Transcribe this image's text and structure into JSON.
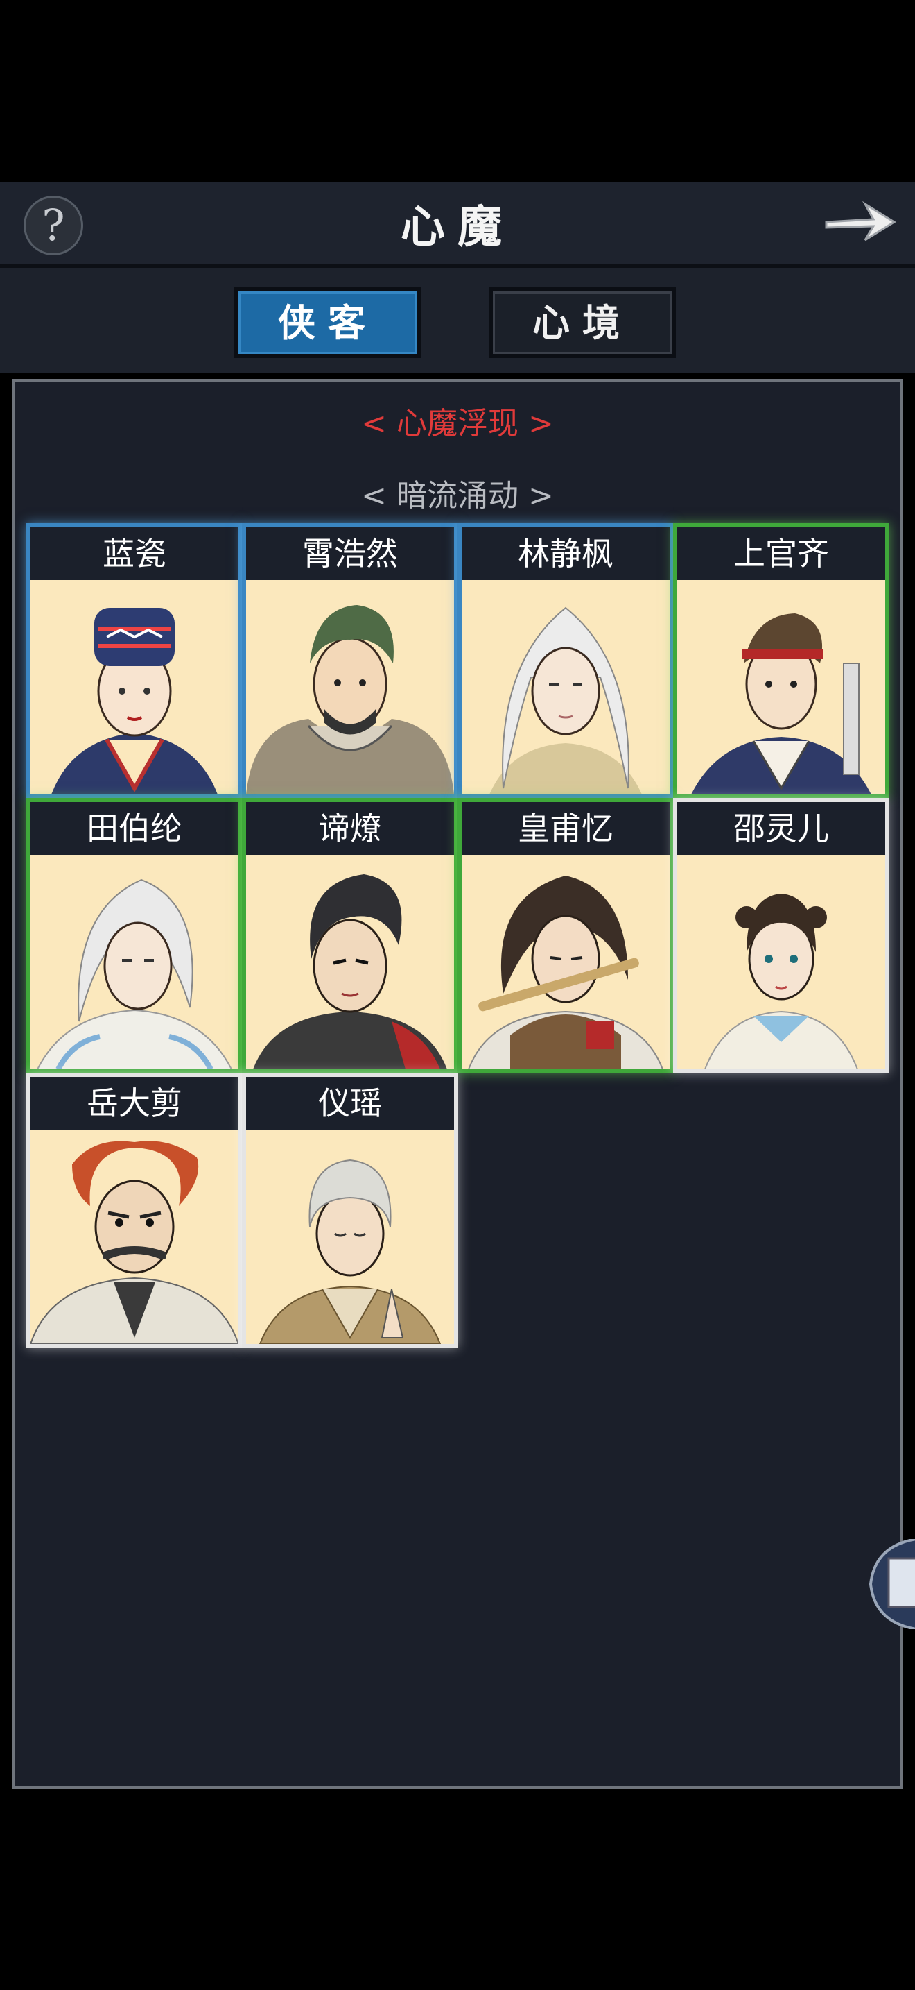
{
  "header": {
    "title": "心魔",
    "help_label": "?"
  },
  "tabs": [
    {
      "label": "侠客",
      "active": true
    },
    {
      "label": "心境",
      "active": false
    }
  ],
  "sections": [
    {
      "label": "< 心魔浮现 >",
      "color": "#e03a3a"
    },
    {
      "label": "< 暗流涌动 >",
      "color": "#b9bcc2"
    }
  ],
  "characters": [
    {
      "name": "蓝瓷",
      "rarity": "blue"
    },
    {
      "name": "霄浩然",
      "rarity": "blue"
    },
    {
      "name": "林静枫",
      "rarity": "blue"
    },
    {
      "name": "上官齐",
      "rarity": "green"
    },
    {
      "name": "田伯纶",
      "rarity": "green"
    },
    {
      "name": "谛燎",
      "rarity": "green"
    },
    {
      "name": "皇甫忆",
      "rarity": "green"
    },
    {
      "name": "邵灵儿",
      "rarity": "white"
    },
    {
      "name": "岳大剪",
      "rarity": "white"
    },
    {
      "name": "仪瑶",
      "rarity": "white"
    }
  ],
  "colors": {
    "blue": "#3a86c2",
    "green": "#3fa83a",
    "white": "#e4e4e4",
    "accent": "#1d6aa5"
  }
}
